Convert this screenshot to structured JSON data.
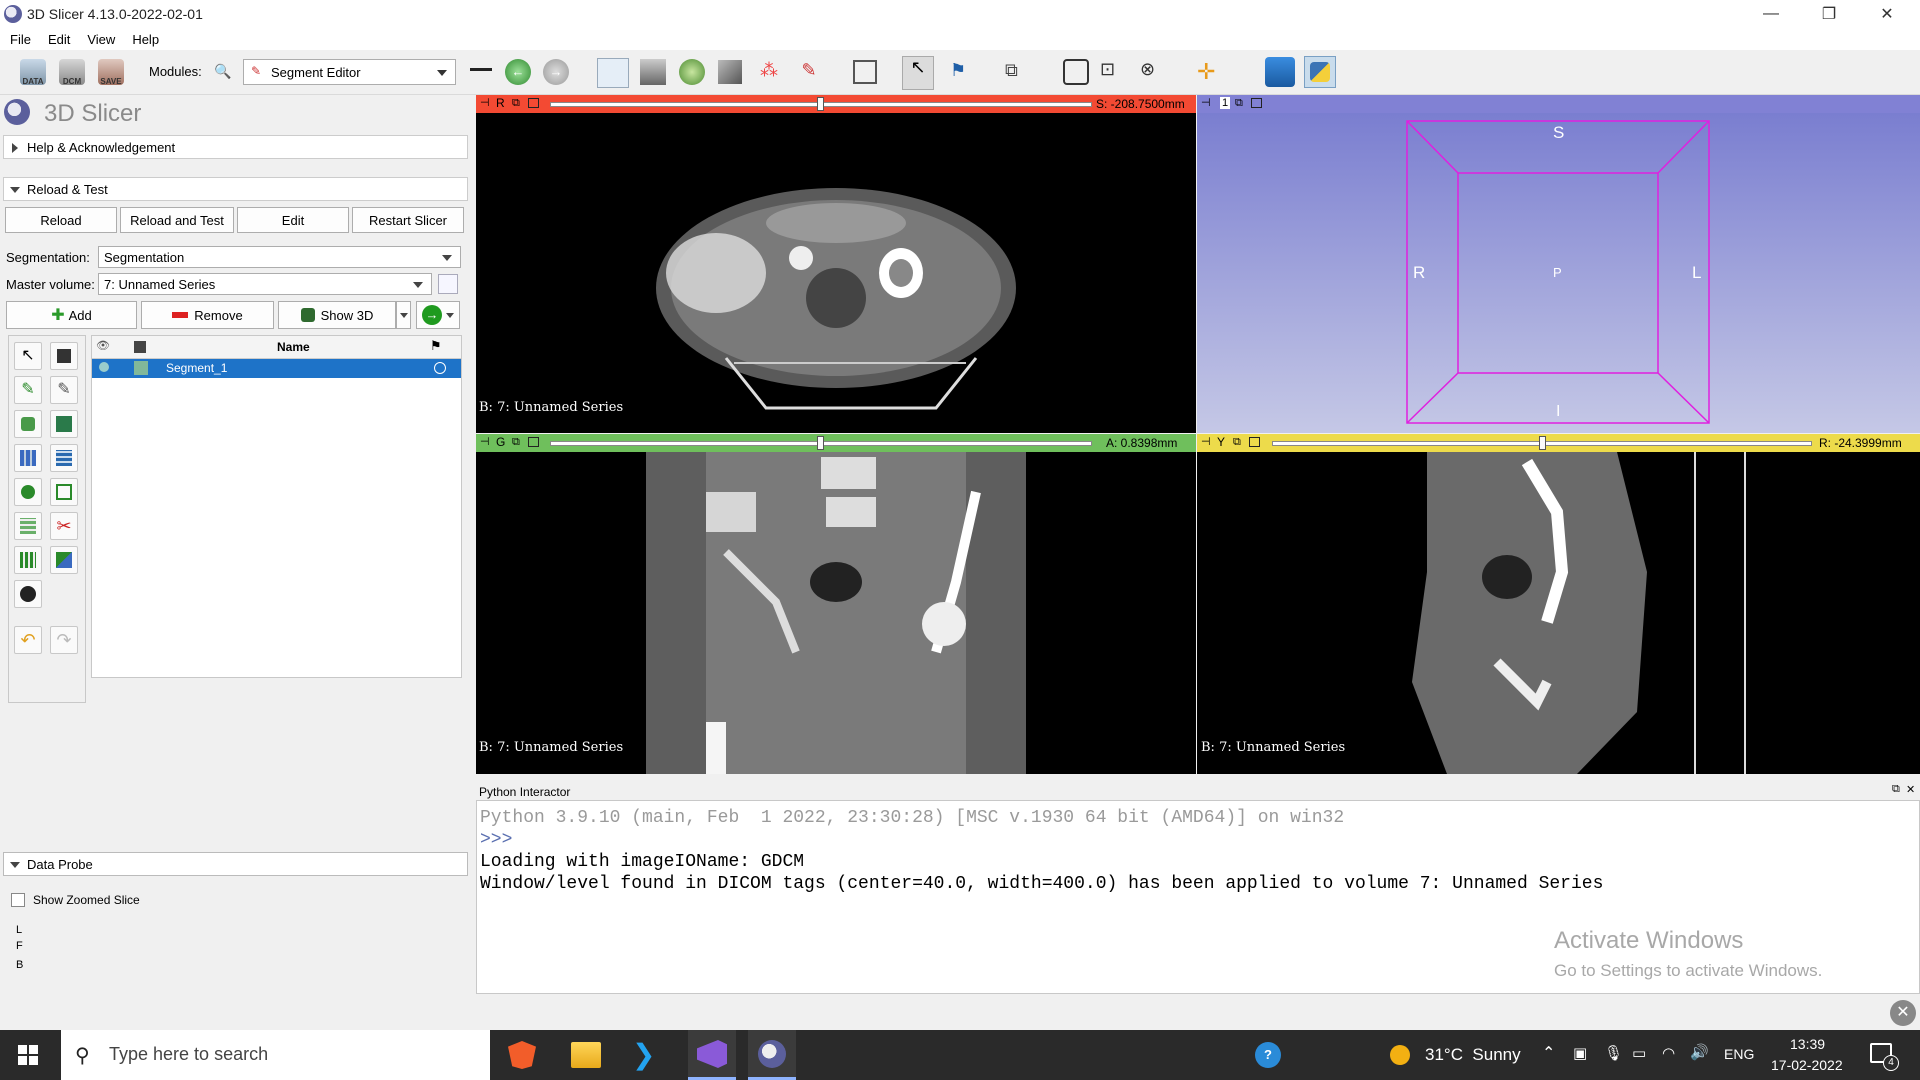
{
  "window": {
    "title": "3D Slicer 4.13.0-2022-02-01",
    "minimize": "—",
    "maximize": "❐",
    "close": "✕"
  },
  "menu": [
    "File",
    "Edit",
    "View",
    "Help"
  ],
  "toolbar": {
    "data_label": "DATA",
    "dcm_label": "DCM",
    "save_label": "SAVE",
    "modules_label": "Modules:",
    "module_selected": "Segment Editor"
  },
  "left": {
    "logo_text": "3D Slicer",
    "help_section": "Help & Acknowledgement",
    "reload_section": "Reload & Test",
    "reload_buttons": [
      "Reload",
      "Reload and Test",
      "Edit",
      "Restart Slicer"
    ],
    "segmentation_label": "Segmentation:",
    "segmentation_value": "Segmentation",
    "master_label": "Master volume:",
    "master_value": "7: Unnamed Series",
    "add_label": "Add",
    "remove_label": "Remove",
    "show3d_label": "Show 3D",
    "table_header_name": "Name",
    "segments": [
      {
        "name": "Segment_1",
        "color": "#81b89a"
      }
    ],
    "data_probe": "Data Probe",
    "show_zoomed": "Show Zoomed Slice",
    "probe_lines": [
      "L",
      "F",
      "B"
    ]
  },
  "views": {
    "red": {
      "letter": "R",
      "offset": "S: -208.7500mm",
      "bottom_label": "B: 7: Unnamed Series",
      "color": "#f34a33",
      "position": 0.5
    },
    "green": {
      "letter": "G",
      "offset": "A: 0.8398mm",
      "bottom_label": "B: 7: Unnamed Series",
      "color": "#6fbf5c",
      "position": 0.5
    },
    "yellow": {
      "letter": "Y",
      "offset": "R: -24.3999mm",
      "bottom_label": "B: 7: Unnamed Series",
      "color": "#eddb4b",
      "position": 0.5
    },
    "three_d": {
      "index": "1",
      "labels": {
        "top": "S",
        "left": "R",
        "right": "L",
        "center": "P",
        "bottom": "I"
      },
      "bar_color": "#8181d4"
    }
  },
  "python": {
    "title": "Python Interactor",
    "lines": [
      {
        "text": "Python 3.9.10 (main, Feb  1 2022, 23:30:28) [MSC v.1930 64 bit (AMD64)] on win32",
        "color": "#9a9a9a"
      },
      {
        "text": ">>>",
        "color": "#5a6fb0"
      },
      {
        "text": "Loading with imageIOName: GDCM",
        "color": "#000000"
      },
      {
        "text": "Window/level found in DICOM tags (center=40.0, width=400.0) has been applied to volume 7: Unnamed Series",
        "color": "#000000"
      }
    ],
    "watermark_title": "Activate Windows",
    "watermark_sub": "Go to Settings to activate Windows."
  },
  "taskbar": {
    "search_placeholder": "Type here to search",
    "weather": "31°C  Sunny",
    "lang": "ENG",
    "time": "13:39",
    "date": "17-02-2022",
    "notifications": "4"
  }
}
